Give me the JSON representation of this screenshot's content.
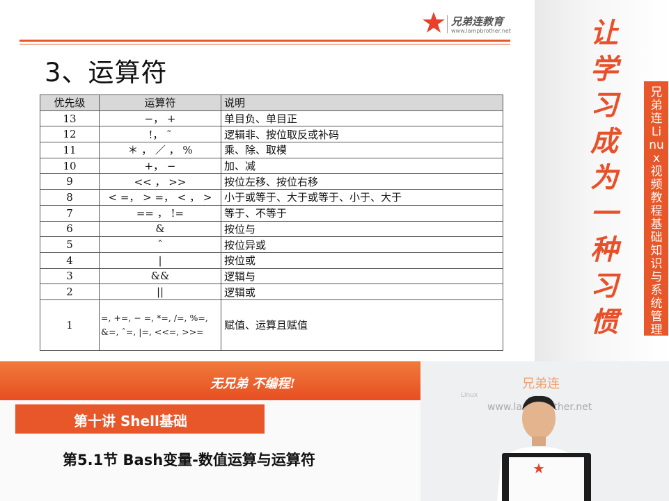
{
  "logo": {
    "brand": "兄弟连教育",
    "url": "www.lampbrother.net"
  },
  "slide": {
    "title": "3、运算符",
    "table": {
      "headers": [
        "优先级",
        "运算符",
        "说明"
      ],
      "rows": [
        {
          "priority": "13",
          "ops": "−， +",
          "desc": "单目负、单目正"
        },
        {
          "priority": "12",
          "ops": "!， ˜",
          "desc": "逻辑非、按位取反或补码"
        },
        {
          "priority": "11",
          "ops": "＊ ， ／ ， %",
          "desc": "乘、除、取模"
        },
        {
          "priority": "10",
          "ops": "+， −",
          "desc": "加、减"
        },
        {
          "priority": "9",
          "ops": "<< ， >>",
          "desc": "按位左移、按位右移"
        },
        {
          "priority": "8",
          "ops": "< =， > =， < ， >",
          "desc": "小于或等于、大于或等于、小于、大于"
        },
        {
          "priority": "7",
          "ops": "== ， !=",
          "desc": "等于、不等于"
        },
        {
          "priority": "6",
          "ops": "&",
          "desc": "按位与"
        },
        {
          "priority": "5",
          "ops": "ˆ",
          "desc": "按位异或"
        },
        {
          "priority": "4",
          "ops": "|",
          "desc": "按位或"
        },
        {
          "priority": "3",
          "ops": "&&",
          "desc": "逻辑与"
        },
        {
          "priority": "2",
          "ops": "||",
          "desc": "逻辑或"
        },
        {
          "priority": "1",
          "ops": "=, +=, − =, *=, /=, %=, &=,  ˆ=, |=,  <<=,  >>=",
          "desc": "赋值、运算且赋值"
        }
      ]
    }
  },
  "sidebar": {
    "slogan": "让学习成为一种习惯",
    "banner": "兄弟连Linux视频教程 基础知识与系统管理"
  },
  "bottom": {
    "slogan": "无兄弟 不编程!",
    "lecture": "第十讲 Shell基础",
    "section": "第5.1节 Bash变量-数值运算与运算符"
  },
  "webcam": {
    "watermark": "兄弟连",
    "linux": "Linux",
    "url": "www.lampbrother.net"
  },
  "colors": {
    "accent": "#e8572a"
  }
}
